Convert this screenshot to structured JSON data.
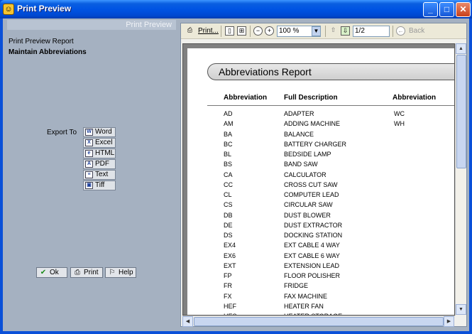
{
  "window": {
    "title": "Print Preview"
  },
  "left": {
    "header": "Print Preview",
    "line1": "Print Preview Report",
    "line2": "Maintain Abbreviations",
    "export_label": "Export To",
    "export_buttons": [
      {
        "label": "Word",
        "icon": "word-icon"
      },
      {
        "label": "Excel",
        "icon": "excel-icon"
      },
      {
        "label": "HTML",
        "icon": "html-icon"
      },
      {
        "label": "PDF",
        "icon": "pdf-icon"
      },
      {
        "label": "Text",
        "icon": "text-icon"
      },
      {
        "label": "Tiff",
        "icon": "tiff-icon"
      }
    ],
    "ok_label": "Ok",
    "print_label": "Print",
    "help_label": "Help"
  },
  "toolbar": {
    "print_label": "Print...",
    "zoom_value": "100 %",
    "page_value": "1/2",
    "back_label": "Back"
  },
  "report": {
    "title": "Abbreviations Report",
    "headers": [
      "Abbreviation",
      "Full Description",
      "Abbreviation"
    ],
    "rows": [
      {
        "abbr": "AD",
        "desc": "ADAPTER",
        "abbr2": "WC"
      },
      {
        "abbr": "AM",
        "desc": "ADDING MACHINE",
        "abbr2": "WH"
      },
      {
        "abbr": "BA",
        "desc": "BALANCE"
      },
      {
        "abbr": "BC",
        "desc": "BATTERY CHARGER"
      },
      {
        "abbr": "BL",
        "desc": "BEDSIDE LAMP"
      },
      {
        "abbr": "BS",
        "desc": "BAND SAW"
      },
      {
        "abbr": "CA",
        "desc": "CALCULATOR"
      },
      {
        "abbr": "CC",
        "desc": "CROSS CUT SAW"
      },
      {
        "abbr": "CL",
        "desc": "COMPUTER LEAD"
      },
      {
        "abbr": "CS",
        "desc": "CIRCULAR SAW"
      },
      {
        "abbr": "DB",
        "desc": "DUST BLOWER"
      },
      {
        "abbr": "DE",
        "desc": "DUST EXTRACTOR"
      },
      {
        "abbr": "DS",
        "desc": "DOCKING STATION"
      },
      {
        "abbr": "EX4",
        "desc": "EXT CABLE 4 WAY"
      },
      {
        "abbr": "EX6",
        "desc": "EXT CABLE 6 WAY"
      },
      {
        "abbr": "EXT",
        "desc": "EXTENSION LEAD"
      },
      {
        "abbr": "FP",
        "desc": "FLOOR POLISHER"
      },
      {
        "abbr": "FR",
        "desc": "FRIDGE"
      },
      {
        "abbr": "FX",
        "desc": "FAX MACHINE"
      },
      {
        "abbr": "HEF",
        "desc": "HEATER FAN"
      },
      {
        "abbr": "HES",
        "desc": "HEATER STORAGE"
      }
    ]
  }
}
